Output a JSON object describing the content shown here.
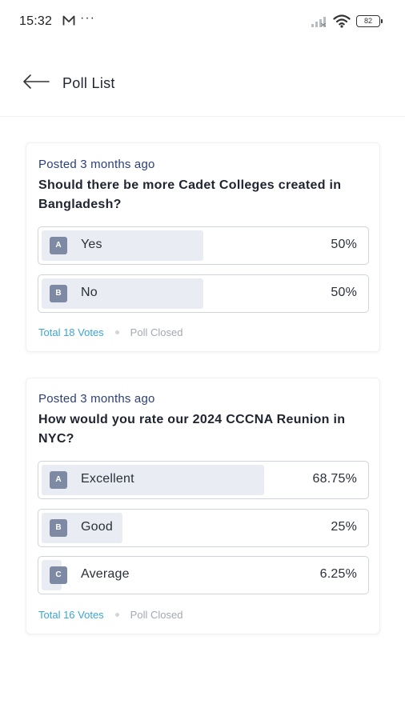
{
  "status_bar": {
    "time": "15:32",
    "dots": "···",
    "battery": "82"
  },
  "header": {
    "title": "Poll List"
  },
  "polls": [
    {
      "posted": "Posted 3 months ago",
      "question": "Should there be more Cadet Colleges created in Bangladesh?",
      "options": [
        {
          "badge": "A",
          "label": "Yes",
          "percent_text": "50%",
          "percent": 50
        },
        {
          "badge": "B",
          "label": "No",
          "percent_text": "50%",
          "percent": 50
        }
      ],
      "votes": "Total 18 Votes",
      "status": "Poll Closed"
    },
    {
      "posted": "Posted 3 months ago",
      "question": "How would you rate  our 2024 CCCNA Reunion in NYC?",
      "options": [
        {
          "badge": "A",
          "label": "Excellent",
          "percent_text": "68.75%",
          "percent": 68.75
        },
        {
          "badge": "B",
          "label": "Good",
          "percent_text": "25%",
          "percent": 25
        },
        {
          "badge": "C",
          "label": "Average",
          "percent_text": "6.25%",
          "percent": 6.25
        }
      ],
      "votes": "Total 16 Votes",
      "status": "Poll Closed"
    }
  ],
  "colors": {
    "accent_text": "#2b3f7a",
    "votes": "#3aa6d6",
    "badge": "#7e8aa3",
    "fill": "#e9ecf2"
  },
  "icons": {
    "back": "arrow-left-icon",
    "mail": "mail-icon",
    "signal": "signal-icon",
    "wifi": "wifi-icon",
    "battery": "battery-icon"
  }
}
